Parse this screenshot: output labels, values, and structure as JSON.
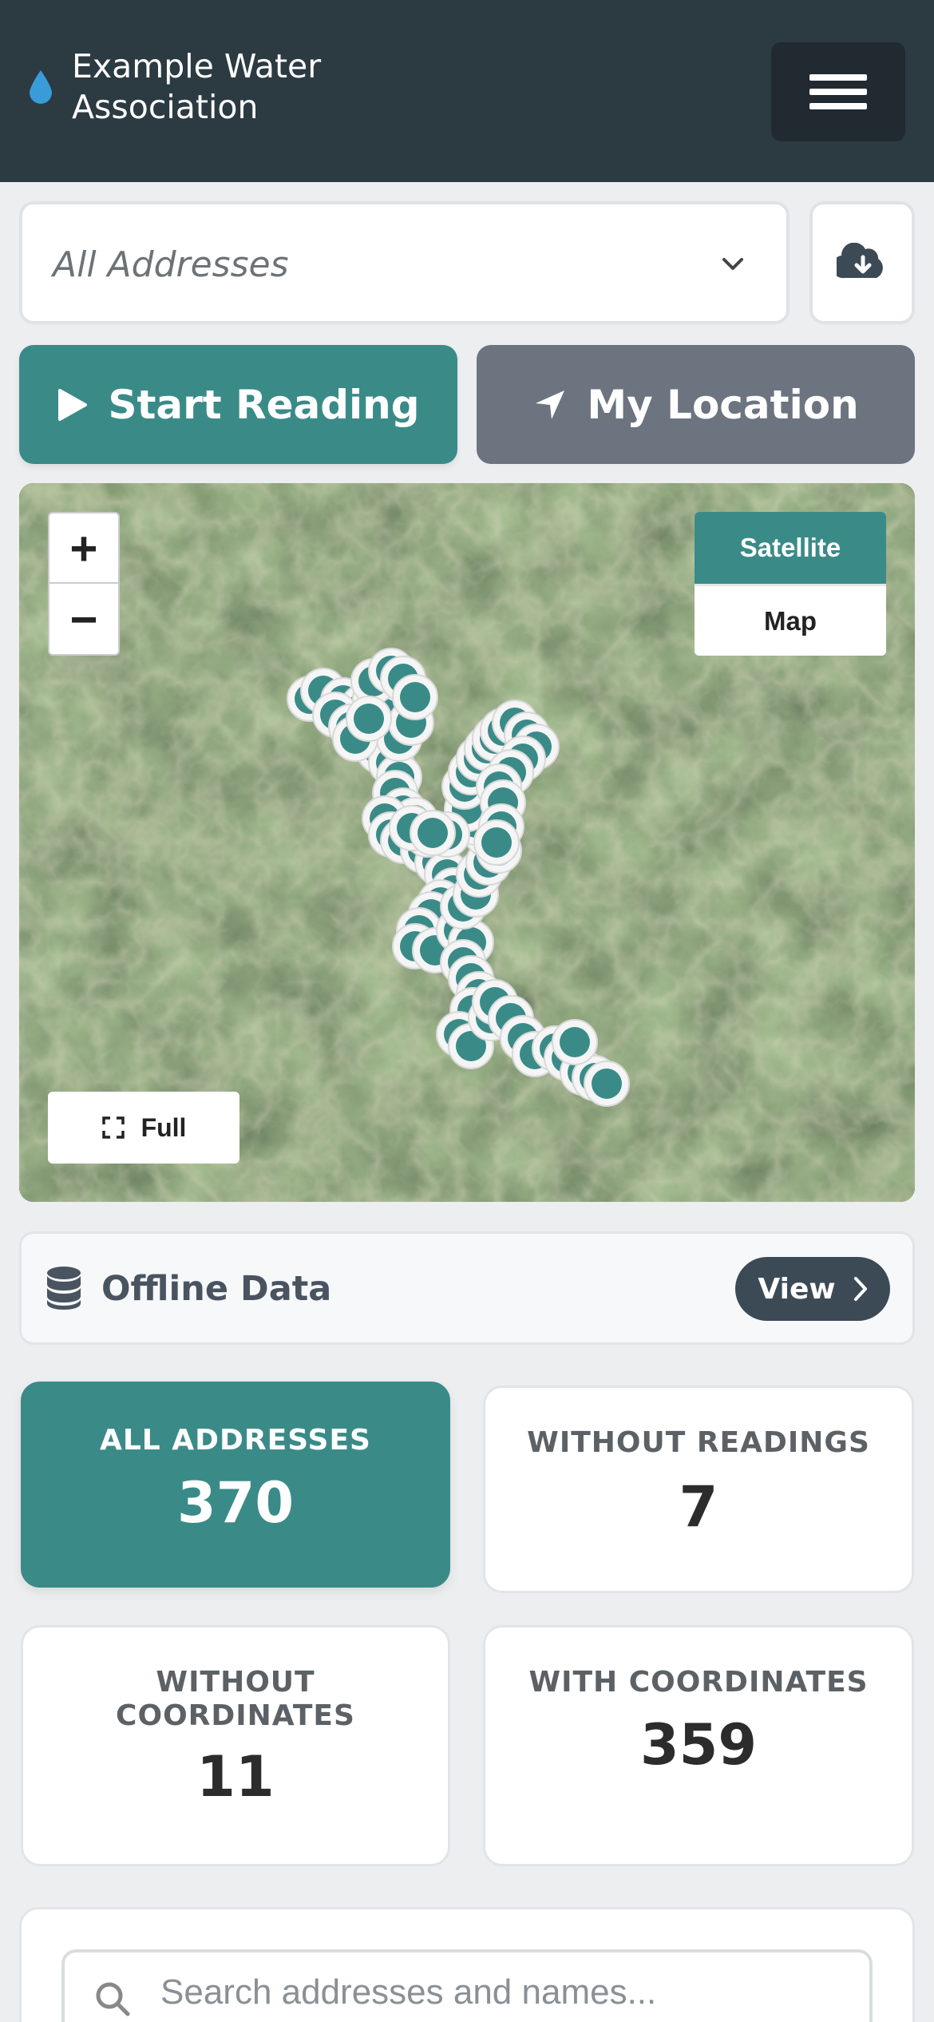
{
  "header": {
    "title": "Example Water Association",
    "brand_icon": "water-drop-icon",
    "menu_icon": "hamburger-menu-icon"
  },
  "filter": {
    "selected": "All Addresses",
    "download_icon": "cloud-download-icon"
  },
  "actions": {
    "start_label": "Start Reading",
    "start_icon": "play-icon",
    "location_label": "My Location",
    "location_icon": "location-arrow-icon"
  },
  "map": {
    "zoom_in": "+",
    "zoom_out": "−",
    "layer_satellite": "Satellite",
    "layer_map": "Map",
    "active_layer": "Satellite",
    "full_label": "Full"
  },
  "offline": {
    "label": "Offline Data",
    "view_label": "View"
  },
  "stats": [
    {
      "title": "ALL ADDRESSES",
      "value": "370",
      "active": true
    },
    {
      "title": "WITHOUT READINGS",
      "value": "7",
      "active": false
    },
    {
      "title": "WITHOUT COORDINATES",
      "value": "11",
      "active": false
    },
    {
      "title": "WITH COORDINATES",
      "value": "359",
      "active": false
    }
  ],
  "search": {
    "placeholder": "Search addresses and names..."
  },
  "colors": {
    "header": "#2c3a42",
    "accent": "#3a8b88",
    "secondary": "#6c7480",
    "drop": "#3a9bd9"
  }
}
